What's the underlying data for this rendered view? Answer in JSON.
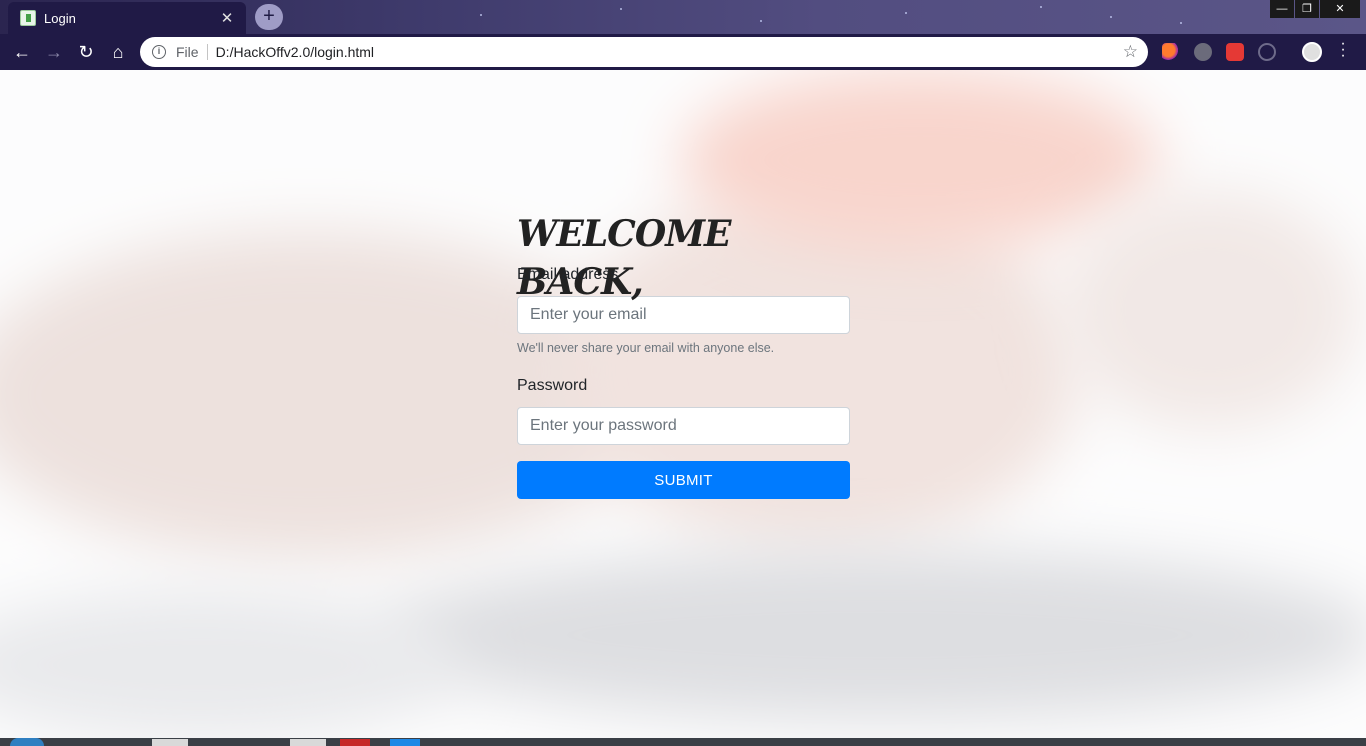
{
  "browser": {
    "tab_title": "Login",
    "tab_close": "✕",
    "new_tab": "+",
    "scheme_label": "File",
    "url": "D:/HackOffv2.0/login.html",
    "window_controls": [
      "—",
      "❐",
      "✕"
    ],
    "nav": {
      "back": "←",
      "forward": "→",
      "reload": "↻",
      "home": "⌂"
    },
    "bookmark_glyph": "☆",
    "info_glyph": "i"
  },
  "login": {
    "heading": "WELCOME BACK,",
    "email_label": "Email address",
    "email_placeholder": "Enter your email",
    "email_help": "We'll never share your email with anyone else.",
    "password_label": "Password",
    "password_placeholder": "Enter your password",
    "submit_label": "SUBMIT"
  },
  "colors": {
    "chrome_dark": "#201a46",
    "primary_button": "#007bff",
    "heading_text": "#222222",
    "help_text": "#6c757d"
  },
  "icons": [
    "info-icon",
    "bookmark-star-icon",
    "back-icon",
    "forward-icon",
    "reload-icon",
    "home-icon",
    "extension-moon-icon",
    "extension-adblock-icon",
    "extension-shield-icon",
    "extension-sync-icon",
    "profile-avatar-icon",
    "menu-dots-icon"
  ]
}
